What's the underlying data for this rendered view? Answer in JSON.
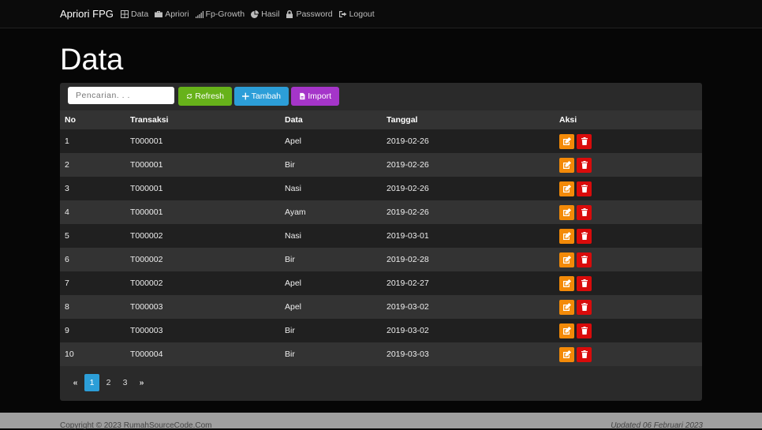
{
  "navbar": {
    "brand": "Apriori FPG",
    "items": [
      {
        "label": "Data",
        "icon": "table-icon"
      },
      {
        "label": "Apriori",
        "icon": "briefcase-icon"
      },
      {
        "label": "Fp-Growth",
        "icon": "signal-icon"
      },
      {
        "label": "Hasil",
        "icon": "pie-chart-icon"
      },
      {
        "label": "Password",
        "icon": "lock-icon"
      },
      {
        "label": "Logout",
        "icon": "logout-icon"
      }
    ]
  },
  "page": {
    "title": "Data"
  },
  "toolbar": {
    "search_placeholder": "Pencarian. . .",
    "refresh_label": "Refresh",
    "add_label": "Tambah",
    "import_label": "Import"
  },
  "table": {
    "headers": [
      "No",
      "Transaksi",
      "Data",
      "Tanggal",
      "Aksi"
    ],
    "rows": [
      [
        "1",
        "T000001",
        "Apel",
        "2019-02-26"
      ],
      [
        "2",
        "T000001",
        "Bir",
        "2019-02-26"
      ],
      [
        "3",
        "T000001",
        "Nasi",
        "2019-02-26"
      ],
      [
        "4",
        "T000001",
        "Ayam",
        "2019-02-26"
      ],
      [
        "5",
        "T000002",
        "Nasi",
        "2019-03-01"
      ],
      [
        "6",
        "T000002",
        "Bir",
        "2019-02-28"
      ],
      [
        "7",
        "T000002",
        "Apel",
        "2019-02-27"
      ],
      [
        "8",
        "T000003",
        "Apel",
        "2019-03-02"
      ],
      [
        "9",
        "T000003",
        "Bir",
        "2019-03-02"
      ],
      [
        "10",
        "T000004",
        "Bir",
        "2019-03-03"
      ]
    ]
  },
  "pagination": {
    "prev": "«",
    "pages": [
      "1",
      "2",
      "3"
    ],
    "active": "1",
    "next": "»"
  },
  "footer": {
    "copyright": "Copyright © 2023 RumahSourceCode.Com",
    "updated": "Updated 06 Februari 2023"
  },
  "colors": {
    "refresh": "#67b21a",
    "add": "#2c9ed8",
    "import": "#a535c9",
    "edit": "#f38a08",
    "delete": "#d90b0b"
  }
}
